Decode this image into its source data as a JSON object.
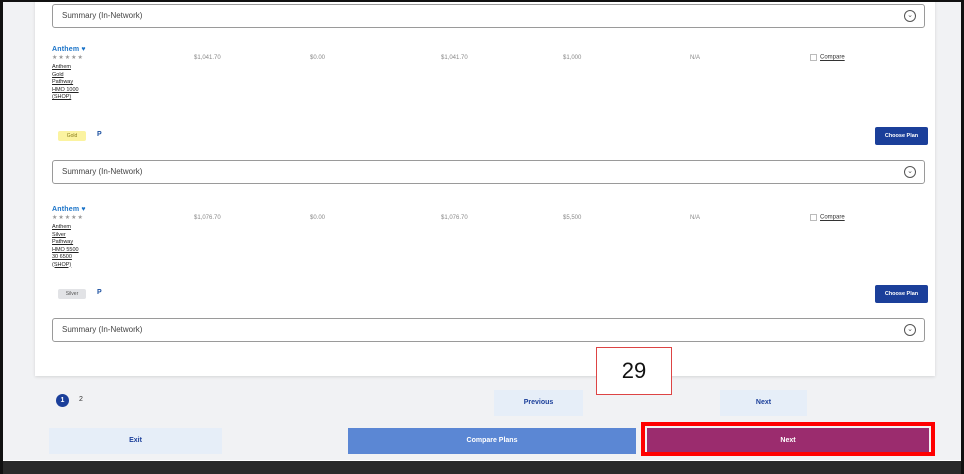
{
  "summaries": {
    "label": "Summary (In-Network)",
    "chevron_glyph": "⌄"
  },
  "plans": [
    {
      "logo": "Anthem ♥",
      "stars": "★★★★★",
      "name": "Anthem Gold Pathway HMO 1000 (SHOP)",
      "premium": "$1,041.70",
      "col2": "$0.00",
      "col3": "$1,041.70",
      "deductible": "$1,000",
      "col5": "N/A",
      "compare_label": "Compare",
      "metal": "Gold",
      "badge": "P",
      "choose_label": "Choose Plan"
    },
    {
      "logo": "Anthem ♥",
      "stars": "★★★★★",
      "name": "Anthem Silver Pathway HMO 5500 30 6500 (SHOP)",
      "premium": "$1,076.70",
      "col2": "$0.00",
      "col3": "$1,076.70",
      "deductible": "$5,500",
      "col5": "N/A",
      "compare_label": "Compare",
      "metal": "Silver",
      "badge": "P",
      "choose_label": "Choose Plan"
    }
  ],
  "pagination": {
    "page1": "1",
    "page2": "2",
    "previous": "Previous",
    "next": "Next"
  },
  "annotation": "29",
  "footer": {
    "exit": "Exit",
    "compare_plans": "Compare Plans",
    "next": "Next"
  },
  "colors": {
    "primary": "#1b3f9a",
    "next_bg": "#9b2c6e",
    "highlight": "#ff0000"
  }
}
